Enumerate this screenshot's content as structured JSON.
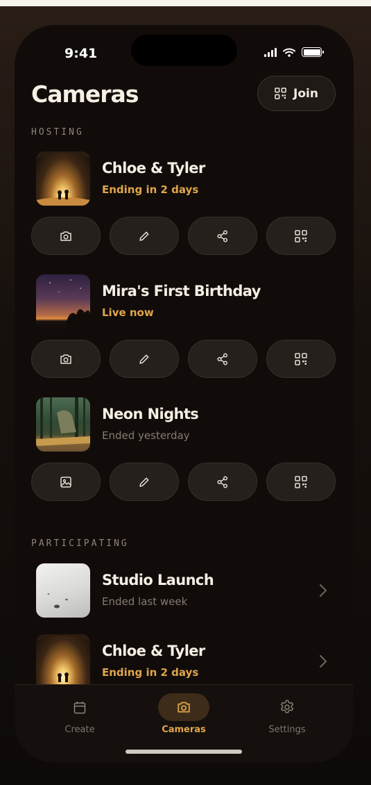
{
  "status_bar": {
    "time": "9:41"
  },
  "header": {
    "title": "Cameras",
    "join_label": "Join"
  },
  "sections": {
    "hosting": "HOSTING",
    "participating": "PARTICIPATING"
  },
  "hosting": [
    {
      "name": "Chloe & Tyler",
      "status": "Ending in 2 days",
      "status_tone": "accent"
    },
    {
      "name": "Mira's First Birthday",
      "status": "Live now",
      "status_tone": "accent"
    },
    {
      "name": "Neon Nights",
      "status": "Ended yesterday",
      "status_tone": "muted"
    }
  ],
  "participating": [
    {
      "name": "Studio Launch",
      "status": "Ended last week",
      "status_tone": "muted"
    },
    {
      "name": "Chloe & Tyler",
      "status": "Ending in 2 days",
      "status_tone": "accent"
    }
  ],
  "action_icons": [
    "camera-icon",
    "pencil-icon",
    "share-icon",
    "qr-code-icon"
  ],
  "ended_action_icons": [
    "photo-icon",
    "pencil-icon",
    "share-icon",
    "qr-code-icon"
  ],
  "tabs": [
    {
      "label": "Create",
      "icon": "calendar-icon",
      "active": false
    },
    {
      "label": "Cameras",
      "icon": "camera-icon",
      "active": true
    },
    {
      "label": "Settings",
      "icon": "gear-icon",
      "active": false
    }
  ],
  "colors": {
    "accent": "#e1a64b",
    "background": "#110c0a",
    "button": "#25201c",
    "muted": "#857b71"
  }
}
